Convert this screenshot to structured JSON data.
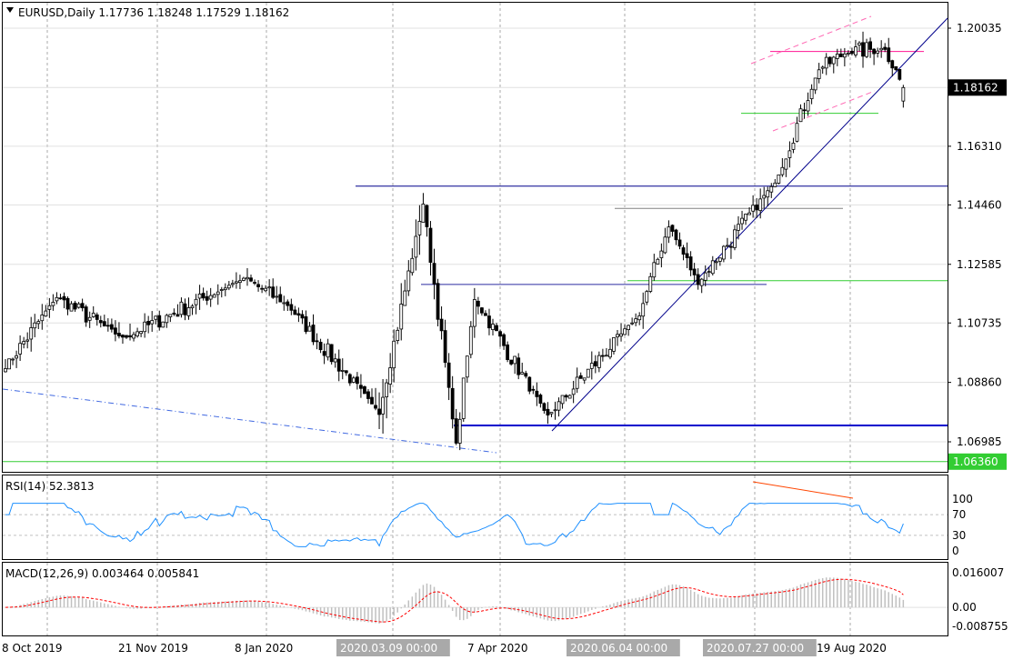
{
  "chart_data": [
    {
      "type": "candlestick",
      "panel": "price",
      "symbol": "EURUSD",
      "timeframe": "Daily",
      "header_text": "EURUSD,Daily  1.17736 1.18248 1.17529 1.18162",
      "ohlc_last": {
        "open": 1.17736,
        "high": 1.18248,
        "low": 1.17529,
        "close": 1.18162
      },
      "y_ticks": [
        "1.20035",
        "1.18162",
        "1.16310",
        "1.14460",
        "1.12585",
        "1.10735",
        "1.08860",
        "1.06985",
        "1.06360"
      ],
      "current_price_label": "1.18162",
      "ylim": [
        1.062,
        1.2115
      ],
      "x_labels": [
        "8 Oct 2019",
        "21 Nov 2019",
        "8 Jan 2020",
        "2020.03.09 00:00",
        "7 Apr 2020",
        "2020.06.04 00:00",
        "2020.07.27 00:00",
        "19 Aug 2020"
      ],
      "key_closes_by_date": [
        {
          "date": "2019-10-01",
          "close": 1.0935
        },
        {
          "date": "2019-10-21",
          "close": 1.1155
        },
        {
          "date": "2019-11-14",
          "close": 1.1025
        },
        {
          "date": "2019-12-31",
          "close": 1.1215
        },
        {
          "date": "2020-01-16",
          "close": 1.113
        },
        {
          "date": "2020-02-20",
          "close": 1.079
        },
        {
          "date": "2020-03-09",
          "close": 1.145
        },
        {
          "date": "2020-03-20",
          "close": 1.069
        },
        {
          "date": "2020-03-27",
          "close": 1.115
        },
        {
          "date": "2020-04-24",
          "close": 1.078
        },
        {
          "date": "2020-05-29",
          "close": 1.11
        },
        {
          "date": "2020-06-10",
          "close": 1.138
        },
        {
          "date": "2020-06-22",
          "close": 1.12
        },
        {
          "date": "2020-07-21",
          "close": 1.152
        },
        {
          "date": "2020-08-06",
          "close": 1.1875
        },
        {
          "date": "2020-08-18",
          "close": 1.193
        },
        {
          "date": "2020-09-01",
          "close": 1.194
        },
        {
          "date": "2020-09-08",
          "close": 1.1816
        }
      ],
      "levels": [
        {
          "price": 1.1505,
          "color": "#00008b"
        },
        {
          "price": 1.1435,
          "color": "#808080"
        },
        {
          "price": 1.1195,
          "color": "#2a2aa0"
        },
        {
          "price": 1.1207,
          "color": "#32cd32"
        },
        {
          "price": 1.193,
          "color": "#ff1493"
        },
        {
          "price": 1.1735,
          "color": "#32cd32"
        },
        {
          "price": 1.075,
          "color": "#0000cd"
        },
        {
          "price": 1.0636,
          "color": "#32cd32"
        }
      ]
    },
    {
      "type": "line",
      "panel": "rsi",
      "header_text": "RSI(14) 52.3813",
      "indicator": "RSI(14)",
      "last_value": 52.3813,
      "y_ticks": [
        "100",
        "70",
        "30",
        "0"
      ],
      "levels": [
        70,
        30
      ],
      "ylim": [
        0,
        100
      ],
      "color": "#1e90ff"
    },
    {
      "type": "bar+line",
      "panel": "macd",
      "header_text": "MACD(12,26,9) 0.003464 0.005841",
      "indicator": "MACD(12,26,9)",
      "macd": 0.003464,
      "signal": 0.005841,
      "y_ticks": [
        "0.016007",
        "0.00",
        "-0.008755"
      ],
      "ylim": [
        -0.008755,
        0.016007
      ],
      "histogram_color": "#c0c0c0",
      "signal_color": "#ff0000"
    }
  ],
  "colors": {
    "background": "#ffffff",
    "candle_up": "#ffffff",
    "candle_down": "#000000",
    "label_bg_dark": "#000000",
    "label_bg_green": "#32cd32"
  }
}
